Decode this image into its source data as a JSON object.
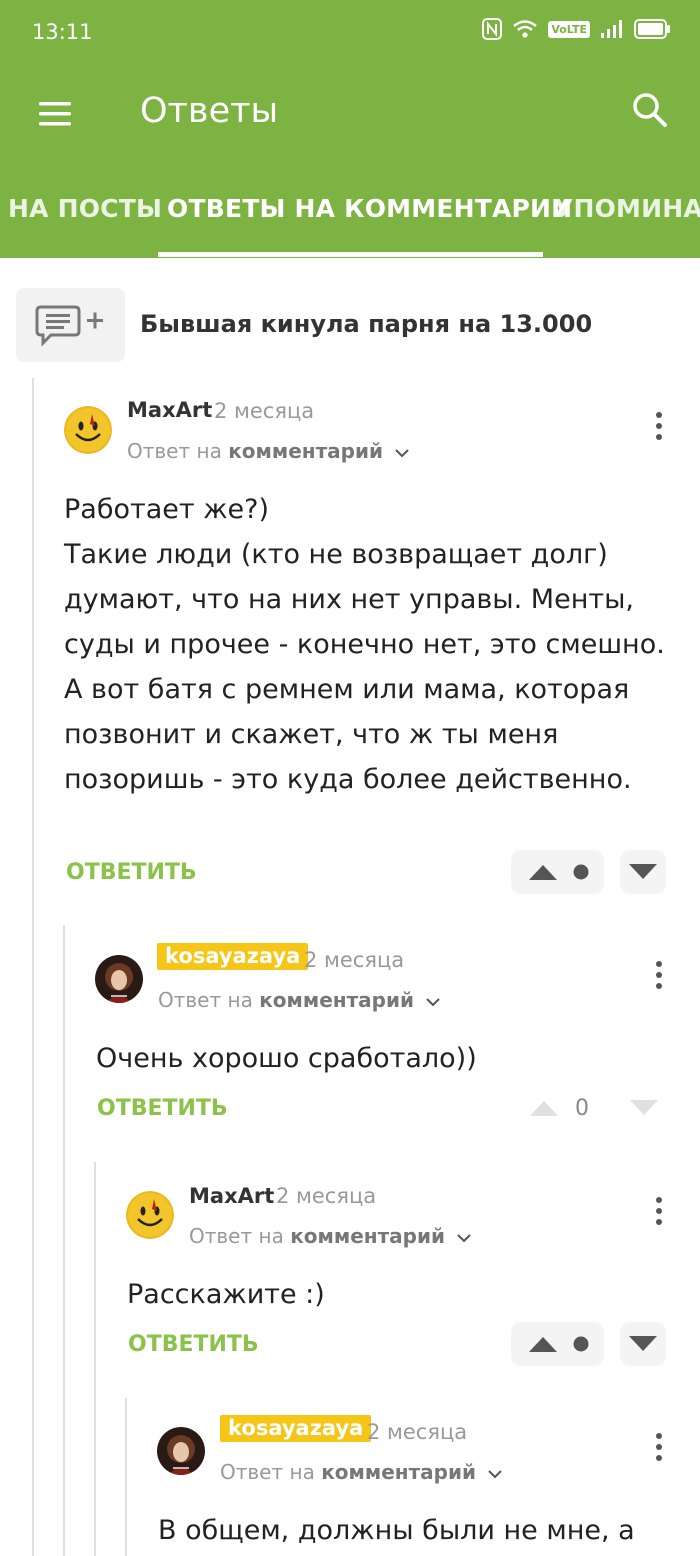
{
  "status_bar": {
    "time": "13:11",
    "volte": "VoLTE"
  },
  "app_bar": {
    "title": "Ответы"
  },
  "tabs": [
    {
      "label": "НА ПОСТЫ",
      "active": false
    },
    {
      "label": "ОТВЕТЫ НА КОММЕНТАРИИ",
      "active": true
    },
    {
      "label": "УПОМИНАНИЯ",
      "active": false
    }
  ],
  "post": {
    "title": "Бывшая кинула парня на 13.000"
  },
  "comments": [
    {
      "author": "MaxArt",
      "age": "2 месяца",
      "reply_prefix": "Ответ на",
      "reply_target": "комментарий",
      "text": "Работает же?)\nТакие люди (кто не возвращает долг) думают, что на них нет управы. Менты, суды и прочее - конечно нет, это смешно.\nА вот батя с ремнем или мама, которая позвонит и скажет, что ж ты меня позоришь - это куда более действенно.",
      "reply_label": "ОТВЕТИТЬ",
      "rating": ""
    },
    {
      "author": "kosayazaya",
      "age": "2 месяца",
      "reply_prefix": "Ответ на",
      "reply_target": "комментарий",
      "text": "Очень хорошо сработало))",
      "reply_label": "ОТВЕТИТЬ",
      "rating": "0"
    },
    {
      "author": "MaxArt",
      "age": "2 месяца",
      "reply_prefix": "Ответ на",
      "reply_target": "комментарий",
      "text": "Расскажите :)",
      "reply_label": "ОТВЕТИТЬ",
      "rating": ""
    },
    {
      "author": "kosayazaya",
      "age": "2 месяца",
      "reply_prefix": "Ответ на",
      "reply_target": "комментарий",
      "text": "В общем, должны были не мне, а",
      "reply_label": "",
      "rating": ""
    }
  ],
  "colors": {
    "brand_green": "#7cb342",
    "reply_green": "#8bc34a",
    "tag_yellow": "#f5c518"
  }
}
